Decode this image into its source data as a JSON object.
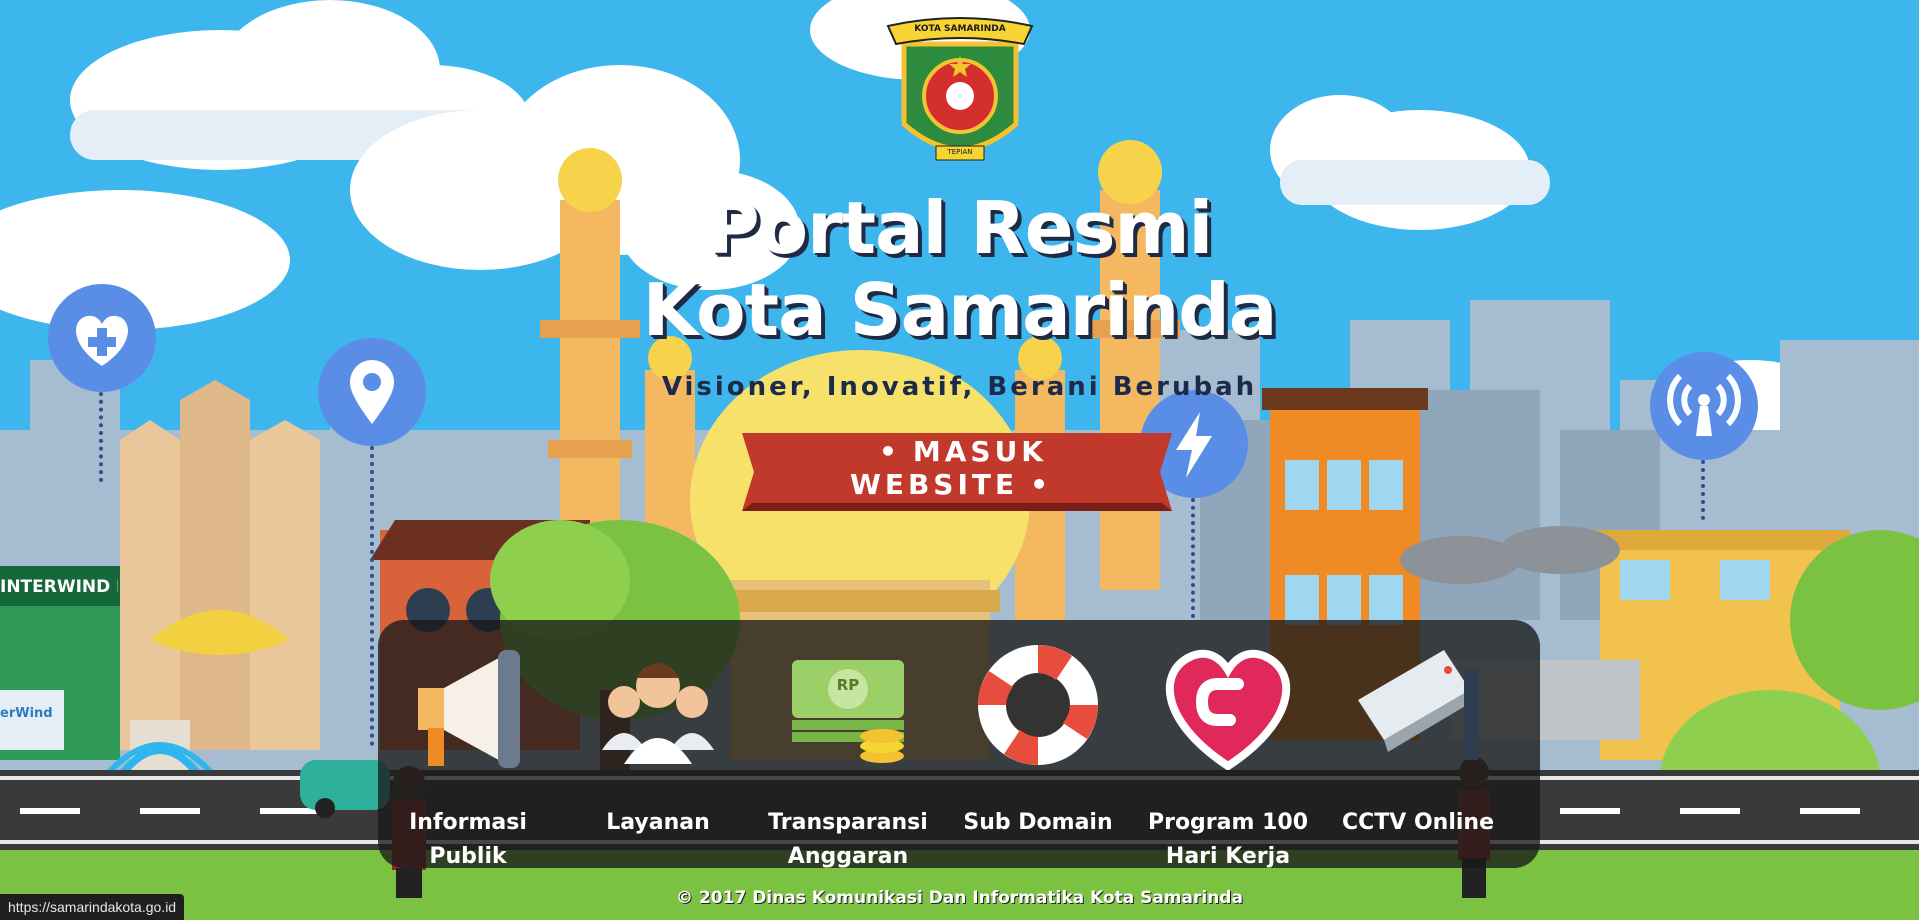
{
  "hero": {
    "title_line1": "Portal Resmi",
    "title_line2": "Kota Samarinda",
    "tagline": "Visioner, Inovatif, Berani Berubah",
    "cta_label": "MASUK WEBSITE"
  },
  "logo": {
    "banner_text": "KOTA SAMARINDA",
    "motto_text": "TEPIAN"
  },
  "scene_signs": {
    "shop_sign": "INTERWIND INC.",
    "shop_logo_text": "erWind"
  },
  "services": [
    {
      "name": "informasi-publik",
      "label1": "Informasi",
      "label2": "Publik",
      "icon": "megaphone-icon"
    },
    {
      "name": "layanan",
      "label1": "Layanan",
      "label2": "",
      "icon": "customer-service-icon"
    },
    {
      "name": "transparansi-anggaran",
      "label1": "Transparansi",
      "label2": "Anggaran",
      "icon": "money-icon",
      "icon_text": "RP"
    },
    {
      "name": "sub-domain",
      "label1": "Sub Domain",
      "label2": "",
      "icon": "lifebuoy-icon"
    },
    {
      "name": "program-100-hari-kerja",
      "label1": "Program 100",
      "label2": "Hari Kerja",
      "icon": "heart-icon"
    },
    {
      "name": "cctv-online",
      "label1": "CCTV Online",
      "label2": "",
      "icon": "cctv-camera-icon"
    }
  ],
  "footer": {
    "copyright": "© 2017 Dinas Komunikasi Dan Informatika Kota Samarinda"
  },
  "statusbar": {
    "url": "https://samarindakota.go.id"
  },
  "colors": {
    "sky": "#3db6ee",
    "cta": "#c0392b",
    "road": "#3a3a3a",
    "grass": "#7cc242",
    "panel": "#191919"
  }
}
